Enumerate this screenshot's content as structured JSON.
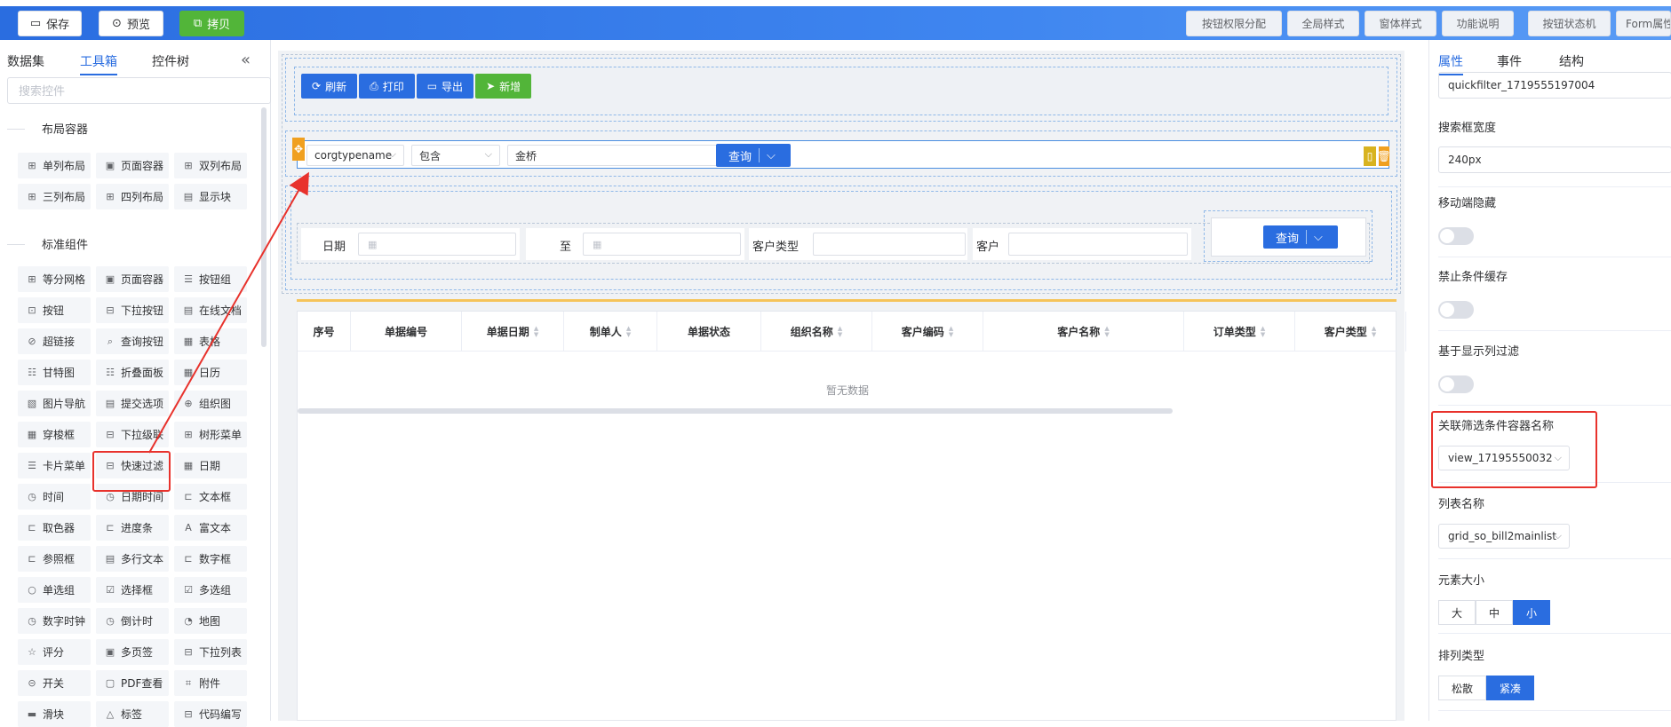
{
  "toolbar": {
    "save": "保存",
    "preview": "预览",
    "copy": "拷贝",
    "right_buttons": [
      "按钮权限分配",
      "全局样式",
      "窗体样式",
      "功能说明",
      "按钮状态机",
      "Form属性"
    ]
  },
  "left_panel": {
    "tabs": [
      "数据集",
      "工具箱",
      "控件树"
    ],
    "active_tab": "工具箱",
    "collapse_icon": "«",
    "search_placeholder": "搜索控件",
    "layout_group_title": "布局容器",
    "layout_items": [
      "单列布局",
      "页面容器",
      "双列布局",
      "三列布局",
      "四列布局",
      "显示块"
    ],
    "standard_group_title": "标准组件",
    "standard_items": [
      "等分网格",
      "页面容器",
      "按钮组",
      "按钮",
      "下拉按钮",
      "在线文档",
      "超链接",
      "查询按钮",
      "表格",
      "甘特图",
      "折叠面板",
      "日历",
      "图片导航",
      "提交选项",
      "组织图",
      "穿梭框",
      "下拉级联",
      "树形菜单",
      "卡片菜单",
      "快速过滤",
      "日期",
      "时间",
      "日期时间",
      "文本框",
      "取色器",
      "进度条",
      "富文本",
      "参照框",
      "多行文本",
      "数字框",
      "单选组",
      "选择框",
      "多选组",
      "数字时钟",
      "倒计时",
      "地图",
      "评分",
      "多页签",
      "下拉列表",
      "开关",
      "PDF查看",
      "附件",
      "滑块",
      "标签",
      "代码编写"
    ]
  },
  "canvas": {
    "action_buttons": [
      "刷新",
      "打印",
      "导出",
      "新增"
    ],
    "quick_filter": {
      "field": "corgtypename",
      "operator": "包含",
      "value": "金桥",
      "query": "查询"
    },
    "conditions": {
      "date_label": "日期",
      "to_label": "至",
      "customer_type_label": "客户类型",
      "customer_label": "客户",
      "query": "查询"
    },
    "table": {
      "columns": [
        "序号",
        "单据编号",
        "单据日期",
        "制单人",
        "单据状态",
        "组织名称",
        "客户编码",
        "客户名称",
        "订单类型",
        "客户类型"
      ],
      "empty_text": "暂无数据"
    }
  },
  "right_panel": {
    "tabs": [
      "属性",
      "事件",
      "结构"
    ],
    "active_tab": "属性",
    "id_value": "quickfilter_1719555197004",
    "search_width_label": "搜索框宽度",
    "search_width_value": "240px",
    "mobile_hide_label": "移动端隐藏",
    "no_cache_label": "禁止条件缓存",
    "col_filter_label": "基于显示列过滤",
    "related_container_label": "关联筛选条件容器名称",
    "related_container_value": "view_17195550032",
    "list_name_label": "列表名称",
    "list_name_value": "grid_so_bill2mainlist",
    "size_label": "元素大小",
    "size_options": [
      "大",
      "中",
      "小"
    ],
    "size_selected": "小",
    "layout_type_label": "排列类型",
    "layout_options": [
      "松散",
      "紧凑"
    ],
    "layout_selected": "紧凑"
  },
  "colors": {
    "primary": "#2a6de0",
    "success": "#52b539",
    "highlight": "#e8322c",
    "warning": "#f0a020"
  }
}
